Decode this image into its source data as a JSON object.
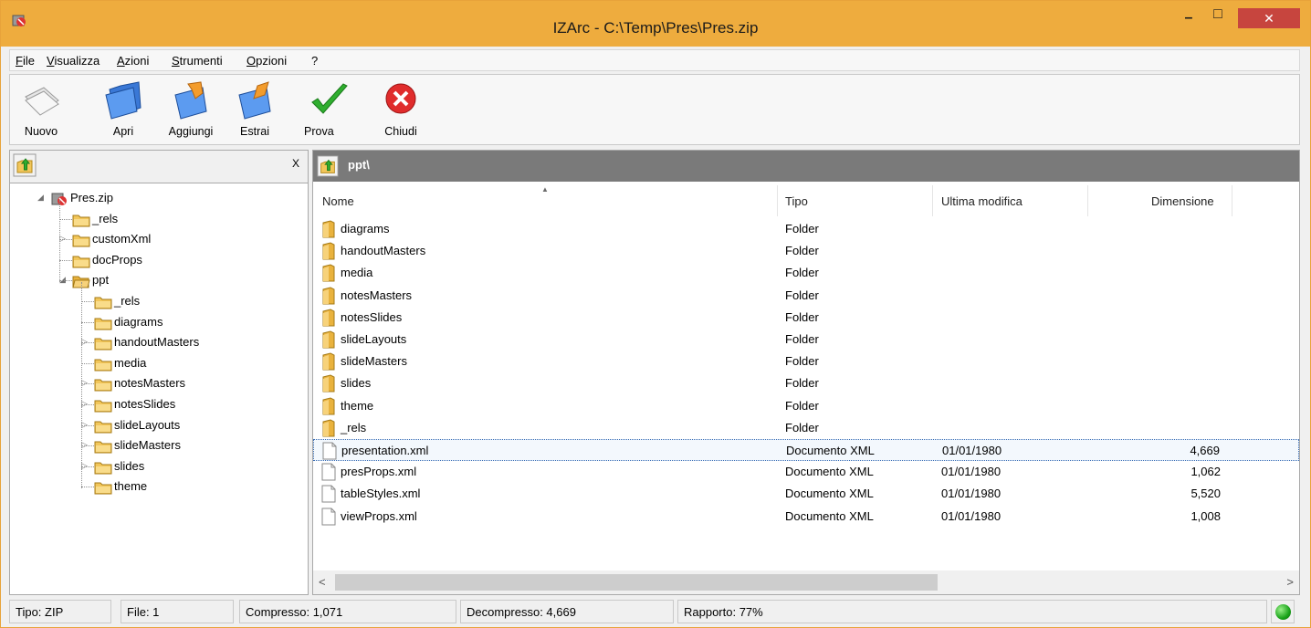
{
  "window": {
    "title": "IZArc - C:\\Temp\\Pres\\Pres.zip",
    "close_label": "✕",
    "min_label": "–",
    "max_label": "□"
  },
  "menu": [
    {
      "u": "F",
      "rest": "ile"
    },
    {
      "u": "V",
      "rest": "isualizza"
    },
    {
      "u": "A",
      "rest": "zioni"
    },
    {
      "u": "S",
      "rest": "trumenti"
    },
    {
      "u": "O",
      "rest": "pzioni"
    },
    {
      "u": "",
      "rest": "?"
    }
  ],
  "toolbar": {
    "nuovo": "Nuovo",
    "apri": "Apri",
    "aggiungi": "Aggiungi",
    "estrai": "Estrai",
    "prova": "Prova",
    "chiudi": "Chiudi"
  },
  "tree_panel": {
    "close_label": "X",
    "items": [
      {
        "label": "Pres.zip",
        "expander": "◢",
        "icon": "zip-icon"
      },
      {
        "label": "_rels",
        "expander": "",
        "icon": "folder-icon"
      },
      {
        "label": "customXml",
        "expander": "▷",
        "icon": "folder-icon"
      },
      {
        "label": "docProps",
        "expander": "",
        "icon": "folder-icon"
      },
      {
        "label": "ppt",
        "expander": "◢",
        "icon": "folder-open-icon"
      },
      {
        "label": "_rels",
        "expander": "",
        "icon": "folder-icon"
      },
      {
        "label": "diagrams",
        "expander": "",
        "icon": "folder-icon"
      },
      {
        "label": "handoutMasters",
        "expander": "▷",
        "icon": "folder-icon"
      },
      {
        "label": "media",
        "expander": "",
        "icon": "folder-icon"
      },
      {
        "label": "notesMasters",
        "expander": "▷",
        "icon": "folder-icon"
      },
      {
        "label": "notesSlides",
        "expander": "▷",
        "icon": "folder-icon"
      },
      {
        "label": "slideLayouts",
        "expander": "▷",
        "icon": "folder-icon"
      },
      {
        "label": "slideMasters",
        "expander": "▷",
        "icon": "folder-icon"
      },
      {
        "label": "slides",
        "expander": "▷",
        "icon": "folder-icon"
      },
      {
        "label": "theme",
        "expander": "",
        "icon": "folder-icon"
      }
    ]
  },
  "file_panel": {
    "path": "ppt\\",
    "columns": {
      "name": "Nome",
      "type": "Tipo",
      "modified": "Ultima modifica",
      "size": "Dimensione"
    },
    "rows": [
      {
        "name": "diagrams",
        "type": "Folder",
        "modified": "",
        "size": "",
        "icon": "folder-icon"
      },
      {
        "name": "handoutMasters",
        "type": "Folder",
        "modified": "",
        "size": "",
        "icon": "folder-icon"
      },
      {
        "name": "media",
        "type": "Folder",
        "modified": "",
        "size": "",
        "icon": "folder-icon"
      },
      {
        "name": "notesMasters",
        "type": "Folder",
        "modified": "",
        "size": "",
        "icon": "folder-icon"
      },
      {
        "name": "notesSlides",
        "type": "Folder",
        "modified": "",
        "size": "",
        "icon": "folder-icon"
      },
      {
        "name": "slideLayouts",
        "type": "Folder",
        "modified": "",
        "size": "",
        "icon": "folder-icon"
      },
      {
        "name": "slideMasters",
        "type": "Folder",
        "modified": "",
        "size": "",
        "icon": "folder-icon"
      },
      {
        "name": "slides",
        "type": "Folder",
        "modified": "",
        "size": "",
        "icon": "folder-icon"
      },
      {
        "name": "theme",
        "type": "Folder",
        "modified": "",
        "size": "",
        "icon": "folder-icon"
      },
      {
        "name": "_rels",
        "type": "Folder",
        "modified": "",
        "size": "",
        "icon": "folder-icon"
      },
      {
        "name": "presentation.xml",
        "type": "Documento XML",
        "modified": "01/01/1980",
        "size": "4,669",
        "icon": "file-icon",
        "selected": true
      },
      {
        "name": "presProps.xml",
        "type": "Documento XML",
        "modified": "01/01/1980",
        "size": "1,062",
        "icon": "file-icon"
      },
      {
        "name": "tableStyles.xml",
        "type": "Documento XML",
        "modified": "01/01/1980",
        "size": "5,520",
        "icon": "file-icon"
      },
      {
        "name": "viewProps.xml",
        "type": "Documento XML",
        "modified": "01/01/1980",
        "size": "1,008",
        "icon": "file-icon"
      }
    ]
  },
  "status": {
    "tipo": "Tipo: ZIP",
    "file": "File: 1",
    "compresso": "Compresso: 1,071",
    "decompresso": "Decompresso: 4,669",
    "rapporto": "Rapporto: 77%"
  },
  "colors": {
    "titlebar": "#eeac3e",
    "close": "#c7453e",
    "folder": "#f2c65a",
    "path_bar": "#7a7a7a"
  }
}
